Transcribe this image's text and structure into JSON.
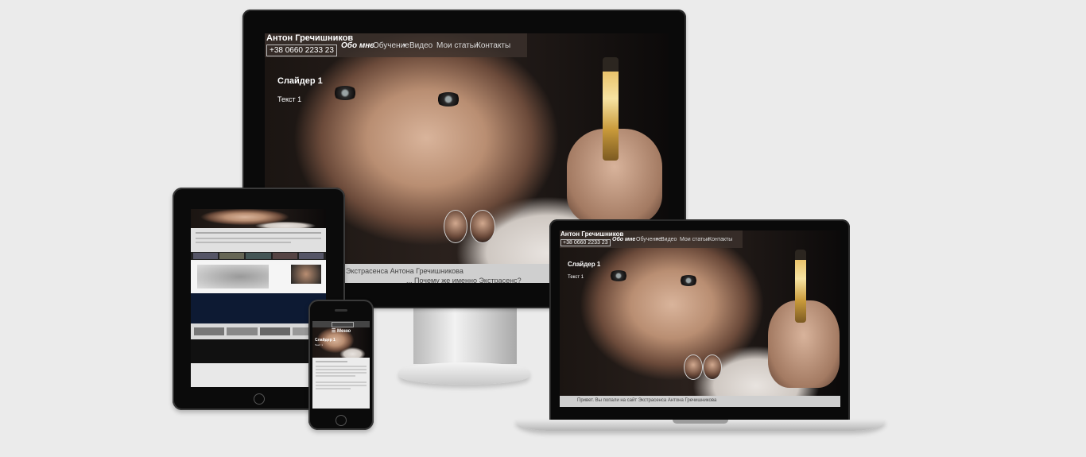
{
  "site": {
    "title": "Антон Гречишников",
    "phone": "+38 0660 2233 23",
    "nav": [
      "Обо мне",
      "Обучение",
      "Видео",
      "Мои статьи",
      "Контакты"
    ],
    "slide_title": "Слайдер 1",
    "slide_text": "Текст 1"
  },
  "monitor": {
    "strip_line1": "Экстрасенса Антона Гречишникова",
    "strip_line2": "... Почему же именно Экстрасенс?"
  },
  "laptop": {
    "strip_text": "Привет. Вы попали на сайт Экстрасенса Антона Гречишникова"
  },
  "phone": {
    "menu_label": "☰ Меню",
    "slide_title": "Слайдер 1",
    "slide_text": "Текст 1"
  },
  "colors": {
    "background": "#ebebeb",
    "nav_bar": "#3c322d",
    "strip": "#cfcfcf"
  }
}
